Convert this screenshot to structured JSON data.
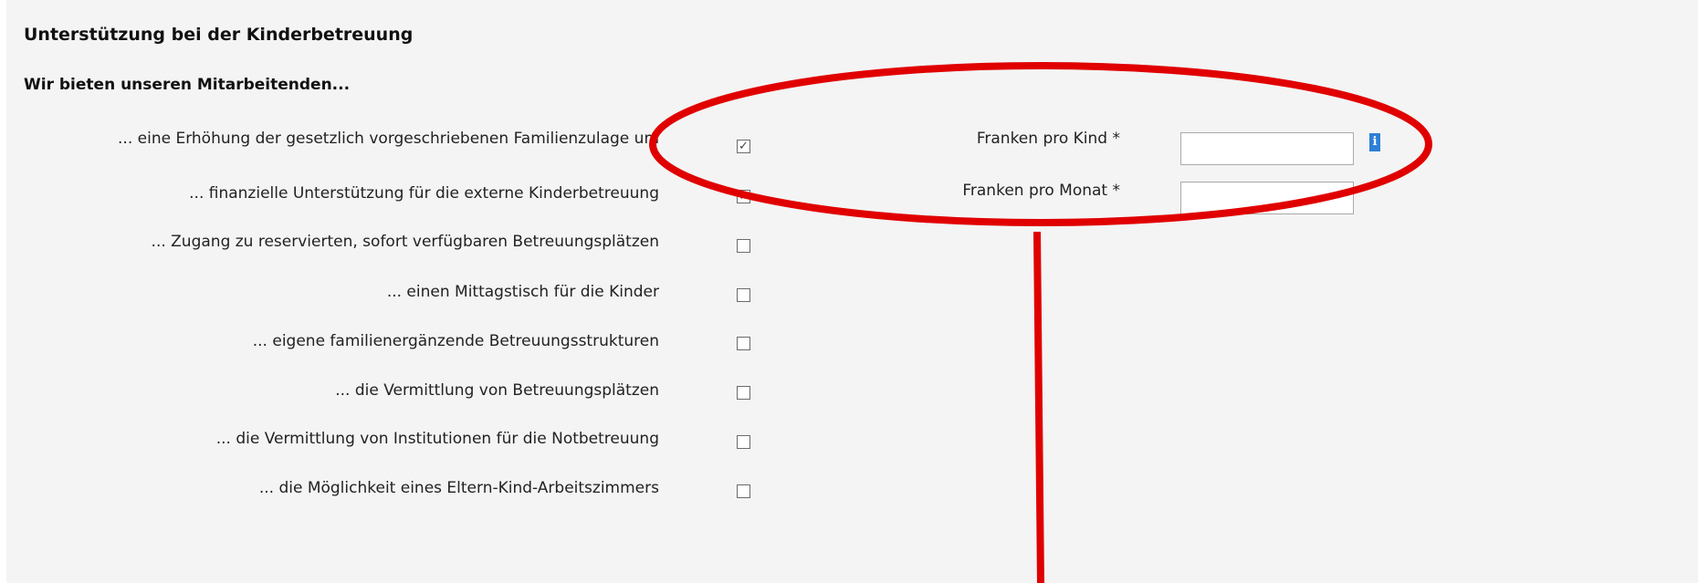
{
  "section": {
    "title": "Unterstützung bei der Kinderbetreuung",
    "subtitle": "Wir bieten unseren Mitarbeitenden..."
  },
  "offers": [
    {
      "label": "... eine Erhöhung der gesetzlich vorgeschriebenen Familienzulage um",
      "checked": true,
      "mark": "✓"
    },
    {
      "label": "... finanzielle Unterstützung für die externe Kinderbetreuung",
      "checked": true,
      "mark": "✓"
    },
    {
      "label": "... Zugang zu reservierten, sofort verfügbaren Betreuungsplätzen",
      "checked": false,
      "mark": ""
    },
    {
      "label": "... einen Mittagstisch für die Kinder",
      "checked": false,
      "mark": ""
    },
    {
      "label": "... eigene familienergänzende Betreuungsstrukturen",
      "checked": false,
      "mark": ""
    },
    {
      "label": "... die Vermittlung von Betreuungsplätzen",
      "checked": false,
      "mark": ""
    },
    {
      "label": "... die Vermittlung von Institutionen für die Notbetreuung",
      "checked": false,
      "mark": ""
    },
    {
      "label": "... die Möglichkeit eines Eltern-Kind-Arbeitszimmers",
      "checked": false,
      "mark": ""
    }
  ],
  "fields": {
    "per_child": {
      "label": "Franken pro Kind *",
      "value": ""
    },
    "per_month": {
      "label": "Franken pro Monat *",
      "value": ""
    }
  },
  "icons": {
    "info": "info-icon",
    "check": "check-icon"
  },
  "colors": {
    "annotation": "#e00000",
    "info_icon": "#2f7fd6",
    "panel_background": "#f4f4f4"
  }
}
